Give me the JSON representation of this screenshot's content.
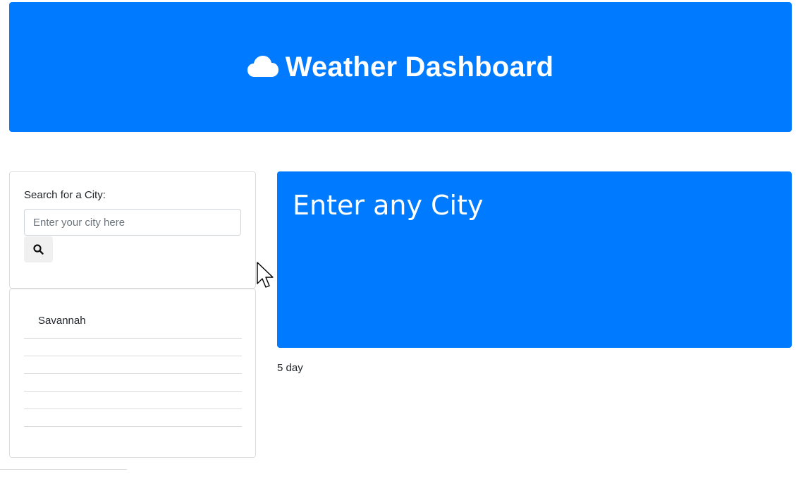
{
  "header": {
    "title": "Weather Dashboard",
    "icon": "cloud-icon",
    "background_color": "#007bff"
  },
  "search": {
    "label": "Search for a City:",
    "placeholder": "Enter your city here",
    "value": "",
    "button_icon": "search-icon"
  },
  "history": {
    "items": [
      {
        "label": "Savannah"
      },
      {
        "label": ""
      },
      {
        "label": ""
      },
      {
        "label": ""
      },
      {
        "label": ""
      },
      {
        "label": ""
      }
    ]
  },
  "result": {
    "title": "Enter any City",
    "background_color": "#007bff"
  },
  "forecast": {
    "label": "5 day"
  }
}
